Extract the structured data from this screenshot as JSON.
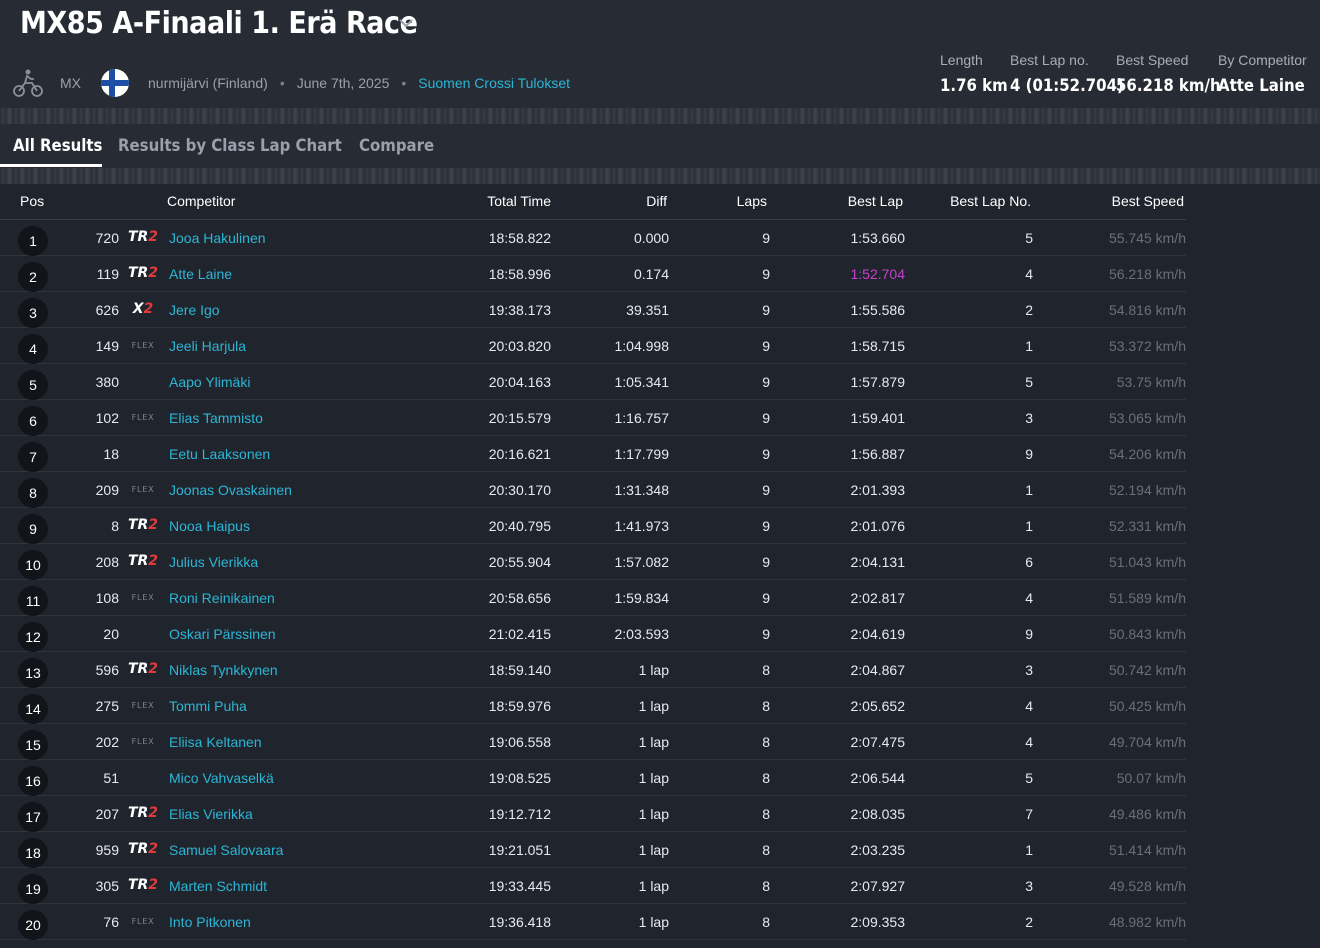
{
  "race": {
    "title": "MX85 A-Finaali 1. Erä Race",
    "type": "MX",
    "location": "nurmijärvi (Finland)",
    "separator": "•",
    "date": "June 7th, 2025",
    "organizer": "Suomen Crossi Tulokset"
  },
  "stats": {
    "length": {
      "label": "Length",
      "value": "1.76 km"
    },
    "best_lap_no": {
      "label": "Best Lap no.",
      "value": "4 (01:52.704)"
    },
    "best_speed": {
      "label": "Best Speed",
      "value": "56.218 km/h"
    },
    "by_competitor": {
      "label": "By Competitor",
      "value": "Atte Laine"
    }
  },
  "tabs": [
    "All Results",
    "Results by Class",
    "Lap Chart",
    "Compare"
  ],
  "table": {
    "headers": {
      "pos": "Pos",
      "competitor": "Competitor",
      "total_time": "Total Time",
      "diff": "Diff",
      "laps": "Laps",
      "best_lap": "Best Lap",
      "best_lap_no": "Best Lap No.",
      "best_speed": "Best Speed"
    },
    "rows": [
      {
        "pos": "1",
        "num": "720",
        "tyre": "TR2",
        "name": "Jooa Hakulinen",
        "total": "18:58.822",
        "diff": "0.000",
        "laps": "9",
        "best": "1:53.660",
        "best_no": "5",
        "speed": "55.745 km/h"
      },
      {
        "pos": "2",
        "num": "119",
        "tyre": "TR2",
        "name": "Atte Laine",
        "total": "18:58.996",
        "diff": "0.174",
        "laps": "9",
        "best": "1:52.704",
        "best_no": "4",
        "speed": "56.218 km/h",
        "fastest": true
      },
      {
        "pos": "3",
        "num": "626",
        "tyre": "X2",
        "name": "Jere Igo",
        "total": "19:38.173",
        "diff": "39.351",
        "laps": "9",
        "best": "1:55.586",
        "best_no": "2",
        "speed": "54.816 km/h"
      },
      {
        "pos": "4",
        "num": "149",
        "tyre": "FLEX",
        "name": "Jeeli Harjula",
        "total": "20:03.820",
        "diff": "1:04.998",
        "laps": "9",
        "best": "1:58.715",
        "best_no": "1",
        "speed": "53.372 km/h"
      },
      {
        "pos": "5",
        "num": "380",
        "tyre": "",
        "name": "Aapo Ylimäki",
        "total": "20:04.163",
        "diff": "1:05.341",
        "laps": "9",
        "best": "1:57.879",
        "best_no": "5",
        "speed": "53.75 km/h"
      },
      {
        "pos": "6",
        "num": "102",
        "tyre": "FLEX",
        "name": "Elias Tammisto",
        "total": "20:15.579",
        "diff": "1:16.757",
        "laps": "9",
        "best": "1:59.401",
        "best_no": "3",
        "speed": "53.065 km/h"
      },
      {
        "pos": "7",
        "num": "18",
        "tyre": "",
        "name": "Eetu Laaksonen",
        "total": "20:16.621",
        "diff": "1:17.799",
        "laps": "9",
        "best": "1:56.887",
        "best_no": "9",
        "speed": "54.206 km/h"
      },
      {
        "pos": "8",
        "num": "209",
        "tyre": "FLEX",
        "name": "Joonas Ovaskainen",
        "total": "20:30.170",
        "diff": "1:31.348",
        "laps": "9",
        "best": "2:01.393",
        "best_no": "1",
        "speed": "52.194 km/h"
      },
      {
        "pos": "9",
        "num": "8",
        "tyre": "TR2",
        "name": "Nooa Haipus",
        "total": "20:40.795",
        "diff": "1:41.973",
        "laps": "9",
        "best": "2:01.076",
        "best_no": "1",
        "speed": "52.331 km/h"
      },
      {
        "pos": "10",
        "num": "208",
        "tyre": "TR2",
        "name": "Julius Vierikka",
        "total": "20:55.904",
        "diff": "1:57.082",
        "laps": "9",
        "best": "2:04.131",
        "best_no": "6",
        "speed": "51.043 km/h"
      },
      {
        "pos": "11",
        "num": "108",
        "tyre": "FLEX",
        "name": "Roni Reinikainen",
        "total": "20:58.656",
        "diff": "1:59.834",
        "laps": "9",
        "best": "2:02.817",
        "best_no": "4",
        "speed": "51.589 km/h"
      },
      {
        "pos": "12",
        "num": "20",
        "tyre": "",
        "name": "Oskari Pärssinen",
        "total": "21:02.415",
        "diff": "2:03.593",
        "laps": "9",
        "best": "2:04.619",
        "best_no": "9",
        "speed": "50.843 km/h"
      },
      {
        "pos": "13",
        "num": "596",
        "tyre": "TR2",
        "name": "Niklas Tynkkynen",
        "total": "18:59.140",
        "diff": "1 lap",
        "laps": "8",
        "best": "2:04.867",
        "best_no": "3",
        "speed": "50.742 km/h"
      },
      {
        "pos": "14",
        "num": "275",
        "tyre": "FLEX",
        "name": "Tommi Puha",
        "total": "18:59.976",
        "diff": "1 lap",
        "laps": "8",
        "best": "2:05.652",
        "best_no": "4",
        "speed": "50.425 km/h"
      },
      {
        "pos": "15",
        "num": "202",
        "tyre": "FLEX",
        "name": "Eliisa Keltanen",
        "total": "19:06.558",
        "diff": "1 lap",
        "laps": "8",
        "best": "2:07.475",
        "best_no": "4",
        "speed": "49.704 km/h"
      },
      {
        "pos": "16",
        "num": "51",
        "tyre": "",
        "name": "Mico Vahvaselkä",
        "total": "19:08.525",
        "diff": "1 lap",
        "laps": "8",
        "best": "2:06.544",
        "best_no": "5",
        "speed": "50.07 km/h"
      },
      {
        "pos": "17",
        "num": "207",
        "tyre": "TR2",
        "name": "Elias Vierikka",
        "total": "19:12.712",
        "diff": "1 lap",
        "laps": "8",
        "best": "2:08.035",
        "best_no": "7",
        "speed": "49.486 km/h"
      },
      {
        "pos": "18",
        "num": "959",
        "tyre": "TR2",
        "name": "Samuel Salovaara",
        "total": "19:21.051",
        "diff": "1 lap",
        "laps": "8",
        "best": "2:03.235",
        "best_no": "1",
        "speed": "51.414 km/h"
      },
      {
        "pos": "19",
        "num": "305",
        "tyre": "TR2",
        "name": "Marten Schmidt",
        "total": "19:33.445",
        "diff": "1 lap",
        "laps": "8",
        "best": "2:07.927",
        "best_no": "3",
        "speed": "49.528 km/h"
      },
      {
        "pos": "20",
        "num": "76",
        "tyre": "FLEX",
        "name": "Into Pitkonen",
        "total": "19:36.418",
        "diff": "1 lap",
        "laps": "8",
        "best": "2:09.353",
        "best_no": "2",
        "speed": "48.982 km/h"
      }
    ]
  },
  "colors": {
    "link": "#2cb6d6",
    "fastest_lap": "#c63fd0",
    "tyre_accent": "#e03a3a"
  }
}
